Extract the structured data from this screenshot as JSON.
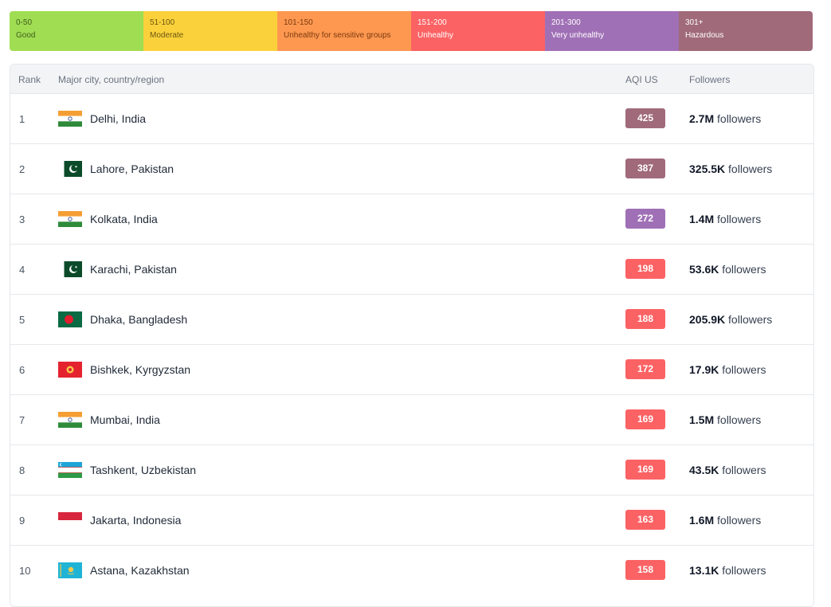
{
  "scale": [
    {
      "range": "0-50",
      "label": "Good",
      "bg": "#a0dd53",
      "fg": "#3f5e1a"
    },
    {
      "range": "51-100",
      "label": "Moderate",
      "bg": "#fbd13b",
      "fg": "#6b5610"
    },
    {
      "range": "101-150",
      "label": "Unhealthy for sensitive groups",
      "bg": "#fe9850",
      "fg": "#7a3a10"
    },
    {
      "range": "151-200",
      "label": "Unhealthy",
      "bg": "#fb6264",
      "fg": "#ffffff"
    },
    {
      "range": "201-300",
      "label": "Very unhealthy",
      "bg": "#a070b6",
      "fg": "#ffffff"
    },
    {
      "range": "301+",
      "label": "Hazardous",
      "bg": "#a06a7b",
      "fg": "#ffffff"
    }
  ],
  "table": {
    "headers": {
      "rank": "Rank",
      "city": "Major city, country/region",
      "aqi": "AQI US",
      "followers": "Followers"
    },
    "rows": [
      {
        "rank": "1",
        "flag": "india",
        "city": "Delhi, India",
        "aqi": "425",
        "aqi_color": "#a06a7b",
        "followers_count": "2.7M",
        "followers_label": "followers"
      },
      {
        "rank": "2",
        "flag": "pakistan",
        "city": "Lahore, Pakistan",
        "aqi": "387",
        "aqi_color": "#a06a7b",
        "followers_count": "325.5K",
        "followers_label": "followers"
      },
      {
        "rank": "3",
        "flag": "india",
        "city": "Kolkata, India",
        "aqi": "272",
        "aqi_color": "#a070b6",
        "followers_count": "1.4M",
        "followers_label": "followers"
      },
      {
        "rank": "4",
        "flag": "pakistan",
        "city": "Karachi, Pakistan",
        "aqi": "198",
        "aqi_color": "#fb6264",
        "followers_count": "53.6K",
        "followers_label": "followers"
      },
      {
        "rank": "5",
        "flag": "bangladesh",
        "city": "Dhaka, Bangladesh",
        "aqi": "188",
        "aqi_color": "#fb6264",
        "followers_count": "205.9K",
        "followers_label": "followers"
      },
      {
        "rank": "6",
        "flag": "kyrgyzstan",
        "city": "Bishkek, Kyrgyzstan",
        "aqi": "172",
        "aqi_color": "#fb6264",
        "followers_count": "17.9K",
        "followers_label": "followers"
      },
      {
        "rank": "7",
        "flag": "india",
        "city": "Mumbai, India",
        "aqi": "169",
        "aqi_color": "#fb6264",
        "followers_count": "1.5M",
        "followers_label": "followers"
      },
      {
        "rank": "8",
        "flag": "uzbekistan",
        "city": "Tashkent, Uzbekistan",
        "aqi": "169",
        "aqi_color": "#fb6264",
        "followers_count": "43.5K",
        "followers_label": "followers"
      },
      {
        "rank": "9",
        "flag": "indonesia",
        "city": "Jakarta, Indonesia",
        "aqi": "163",
        "aqi_color": "#fb6264",
        "followers_count": "1.6M",
        "followers_label": "followers"
      },
      {
        "rank": "10",
        "flag": "kazakhstan",
        "city": "Astana, Kazakhstan",
        "aqi": "158",
        "aqi_color": "#fb6264",
        "followers_count": "13.1K",
        "followers_label": "followers"
      }
    ]
  }
}
